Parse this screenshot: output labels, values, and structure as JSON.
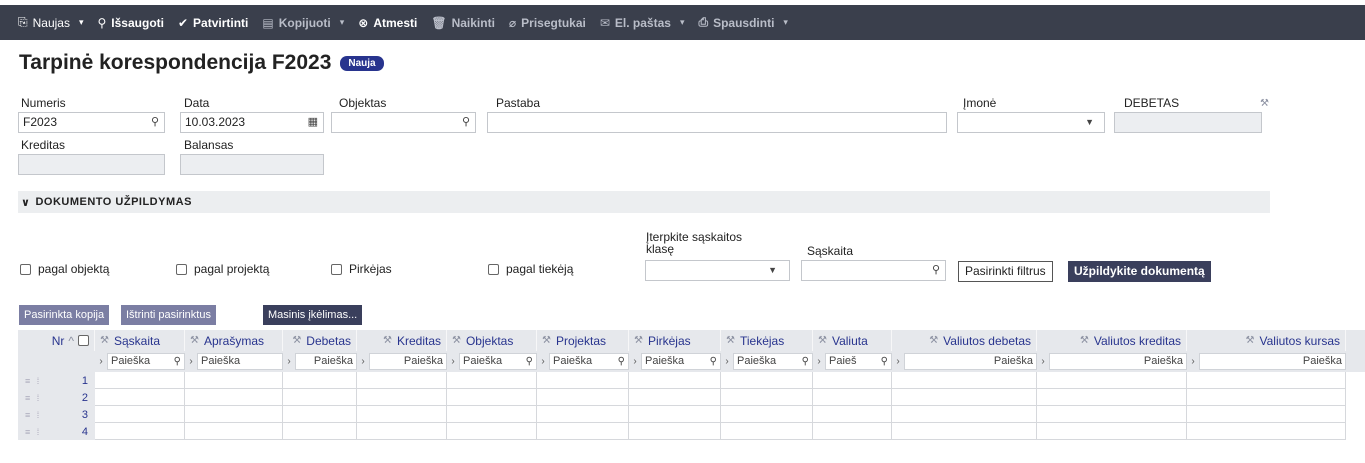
{
  "toolbar": {
    "items": [
      {
        "label": "Naujas",
        "icon": "new-doc-icon",
        "glyph": "⎘",
        "caret": true,
        "dim": false,
        "bold": false
      },
      {
        "label": "Išsaugoti",
        "icon": "save-icon",
        "glyph": "⚲",
        "caret": false,
        "dim": false,
        "bold": true
      },
      {
        "label": "Patvirtinti",
        "icon": "check-icon",
        "glyph": "✔",
        "caret": false,
        "dim": false,
        "bold": true
      },
      {
        "label": "Kopijuoti",
        "icon": "copy-icon",
        "glyph": "▤",
        "caret": true,
        "dim": true,
        "bold": true
      },
      {
        "label": "Atmesti",
        "icon": "cancel-icon",
        "glyph": "⊗",
        "caret": false,
        "dim": false,
        "bold": true
      },
      {
        "label": "Naikinti",
        "icon": "trash-icon",
        "glyph": "🗑",
        "caret": false,
        "dim": true,
        "bold": true
      },
      {
        "label": "Prisegtukai",
        "icon": "paperclip-icon",
        "glyph": "⌀",
        "caret": false,
        "dim": true,
        "bold": true
      },
      {
        "label": "El. paštas",
        "icon": "email-icon",
        "glyph": "✉",
        "caret": true,
        "dim": true,
        "bold": true
      },
      {
        "label": "Spausdinti",
        "icon": "printer-icon",
        "glyph": "⎙",
        "caret": true,
        "dim": true,
        "bold": true
      }
    ]
  },
  "page": {
    "title": "Tarpinė korespondencija F2023",
    "badge": "Nauja"
  },
  "form": {
    "numeris_label": "Numeris",
    "numeris_value": "F2023",
    "data_label": "Data",
    "data_value": "10.03.2023",
    "objektas_label": "Objektas",
    "objektas_value": "",
    "pastaba_label": "Pastaba",
    "pastaba_value": "",
    "imone_label": "Įmonė",
    "imone_value": "",
    "debetas_label": "DEBETAS",
    "debetas_value": "",
    "kreditas_label": "Kreditas",
    "kreditas_value": "",
    "balansas_label": "Balansas",
    "balansas_value": ""
  },
  "section": {
    "title": "DOKUMENTO UŽPILDYMAS"
  },
  "filters": {
    "pagal_objekta": "pagal objektą",
    "pagal_projekta": "pagal projektą",
    "pirkejas": "Pirkėjas",
    "pagal_tiekeja": "pagal tiekėją",
    "klase_label_1": "Įterpkite sąskaitos",
    "klase_label_2": "klasę",
    "saskaita_label": "Sąskaita",
    "btn_filters": "Pasirinkti filtrus",
    "btn_fill": "Užpildykite dokumentą"
  },
  "actions": {
    "copy_selected": "Pasirinkta kopija",
    "delete_selected": "Ištrinti pasirinktus",
    "mass_insert": "Masinis įkėlimas..."
  },
  "grid": {
    "nr_label": "Nr",
    "columns": [
      {
        "label": "Sąskaita",
        "filter": "Paieška"
      },
      {
        "label": "Aprašymas",
        "filter": "Paieška"
      },
      {
        "label": "Debetas",
        "filter": "Paieška"
      },
      {
        "label": "Kreditas",
        "filter": "Paieška"
      },
      {
        "label": "Objektas",
        "filter": "Paieška"
      },
      {
        "label": "Projektas",
        "filter": "Paieška"
      },
      {
        "label": "Pirkėjas",
        "filter": "Paieška"
      },
      {
        "label": "Tiekėjas",
        "filter": "Paieška"
      },
      {
        "label": "Valiuta",
        "filter": "Paieš"
      },
      {
        "label": "Valiutos debetas",
        "filter": "Paieška"
      },
      {
        "label": "Valiutos kreditas",
        "filter": "Paieška"
      },
      {
        "label": "Valiutos kursas",
        "filter": "Paieška"
      }
    ],
    "rows": [
      "1",
      "2",
      "3",
      "4"
    ]
  }
}
